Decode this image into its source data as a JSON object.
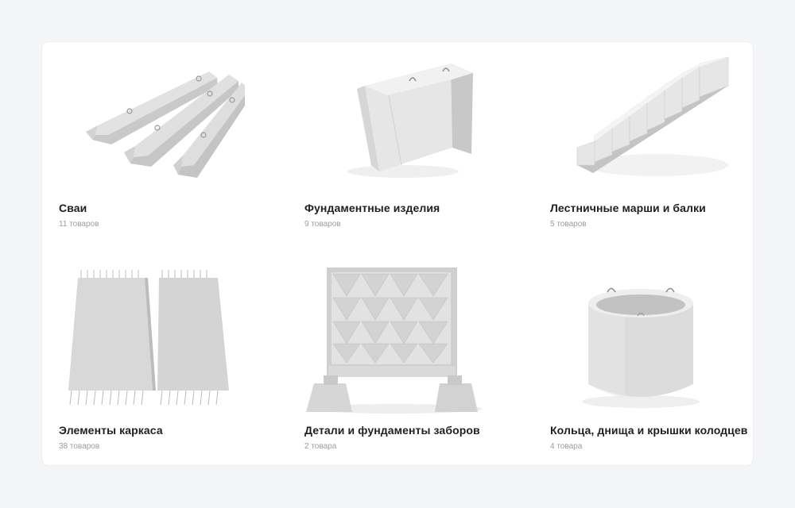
{
  "categories": [
    {
      "title": "Сваи",
      "count": "11 товаров",
      "image": "piles-image"
    },
    {
      "title": "Фундаментные изделия",
      "count": "9 товаров",
      "image": "foundation-block-image"
    },
    {
      "title": "Лестничные марши и балки",
      "count": "5 товаров",
      "image": "staircase-image"
    },
    {
      "title": "Элементы каркаса",
      "count": "38 товаров",
      "image": "frame-slabs-image"
    },
    {
      "title": "Детали и фундаменты заборов",
      "count": "2 товара",
      "image": "fence-panel-image"
    },
    {
      "title": "Кольца, днища и крышки колодцев",
      "count": "4 товара",
      "image": "well-ring-image"
    }
  ],
  "colors": {
    "page_background": "#f4f5f7",
    "panel_background": "#ffffff",
    "title_text": "#1f1f21",
    "count_text": "#9a9ca3",
    "concrete": "#d9d9d9"
  }
}
